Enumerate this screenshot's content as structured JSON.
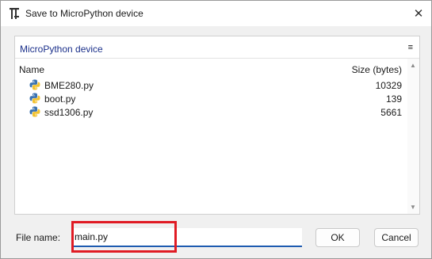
{
  "window": {
    "title": "Save to MicroPython device",
    "close_glyph": "✕"
  },
  "panel": {
    "title": "MicroPython device",
    "menu_glyph": "≡"
  },
  "columns": {
    "name": "Name",
    "size": "Size (bytes)"
  },
  "files": [
    {
      "name": "BME280.py",
      "size": "10329",
      "icon": "python-file-icon"
    },
    {
      "name": "boot.py",
      "size": "139",
      "icon": "python-file-icon"
    },
    {
      "name": "ssd1306.py",
      "size": "5661",
      "icon": "python-file-icon"
    }
  ],
  "scrollbar": {
    "up_glyph": "▲",
    "down_glyph": "▼"
  },
  "form": {
    "filename_label": "File name:",
    "filename_value": "main.py"
  },
  "buttons": {
    "ok": "OK",
    "cancel": "Cancel"
  },
  "colors": {
    "panel_title": "#1a2f8a",
    "input_underline": "#1e5bb0",
    "highlight": "#e01b24"
  }
}
